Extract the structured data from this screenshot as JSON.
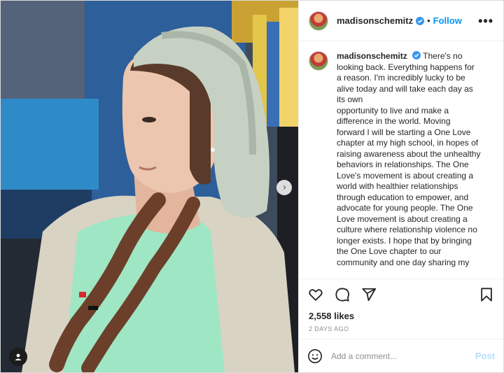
{
  "post": {
    "username": "madisonschemitz",
    "follow_label": "Follow",
    "separator": "•",
    "more_label": "•••",
    "caption_lines": [
      "There's no",
      "looking back. Everything happens for",
      "a reason. I'm incredibly lucky to be",
      "alive today and will take each day as",
      "its own",
      "opportunity to live and make a",
      "difference in the world. Moving",
      "forward I will be starting a One Love",
      "chapter at my high school, in hopes of",
      "raising awareness about the unhealthy",
      "behaviors in relationships. The One",
      "Love's movement is about creating a",
      "world with healthier relationships",
      "through education to empower, and",
      "advocate for young people. The One",
      "Love movement is about creating a",
      "culture where relationship violence no",
      "longer exists. I hope that by bringing",
      "the One Love chapter to our",
      "community and one day sharing my"
    ],
    "likes": "2,558 likes",
    "date": "2 DAYS AGO",
    "comment_placeholder": "Add a comment...",
    "post_label": "Post"
  },
  "icons": {
    "like": "heart-icon",
    "comment": "comment-icon",
    "share": "paper-plane-icon",
    "save": "bookmark-icon",
    "emoji": "smiley-icon",
    "verified": "verified-badge-icon",
    "next": "chevron-right-icon",
    "tag": "user-tag-icon"
  },
  "colors": {
    "accent": "#0095f6",
    "post_disabled": "#b2dffc",
    "muted": "#8e8e8e"
  }
}
